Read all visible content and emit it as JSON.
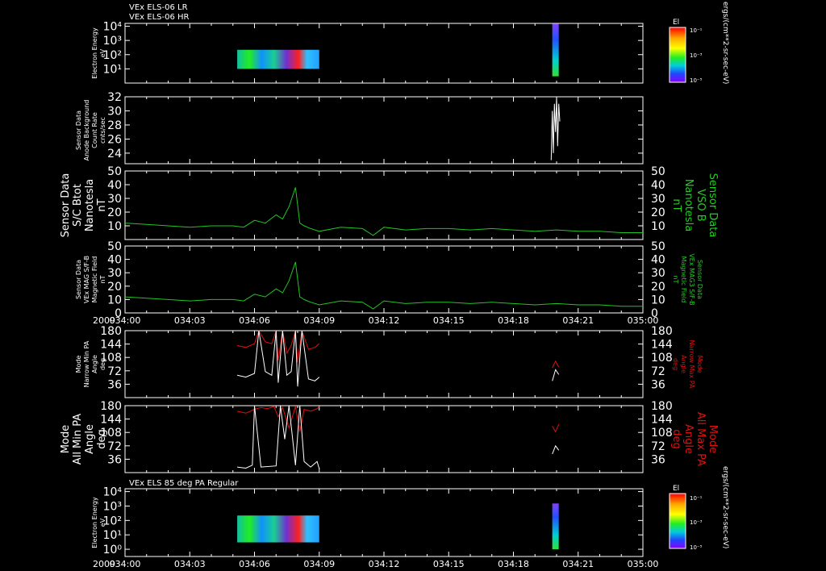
{
  "header": {
    "line1": "VEx ELS-06 LR",
    "line2": "VEx ELS-06 HR",
    "bottom_panel_title": "VEx ELS 85 deg PA Regular"
  },
  "colors": {
    "background": "#000000",
    "axis": "#ffffff",
    "green_series": "#22c422",
    "red_series": "#e01010",
    "white_series": "#ffffff",
    "green_label": "#22cc22",
    "red_label": "#dd1111"
  },
  "colorbar": {
    "label": "El",
    "ticks": [
      "10⁻¹",
      "10⁻³",
      "10⁻⁵"
    ],
    "units": "ergs/(cm**2-sr-sec-eV)"
  },
  "time_axis": {
    "year": "2009",
    "ticks": [
      "034:00",
      "034:03",
      "034:06",
      "034:09",
      "034:12",
      "034:15",
      "034:18",
      "034:21",
      "035:00"
    ]
  },
  "chart_data": [
    {
      "type": "heatmap",
      "panel": "spectrogram-top",
      "ylabel": [
        "Electron Energy",
        "eV"
      ],
      "yticks": [
        "10⁴",
        "10³",
        "10²",
        "10¹"
      ],
      "log_y": true,
      "ylim_log10": [
        0,
        4.2
      ],
      "blocks": [
        {
          "x_start": "034:05.2",
          "x_end": "034:09.0",
          "energy_min": 10,
          "energy_max": 220
        },
        {
          "x_start": "034:19.8",
          "x_end": "034:20.1",
          "energy_min": 3,
          "energy_max": 15000
        }
      ]
    },
    {
      "type": "line",
      "panel": "anode-background",
      "ylabel": [
        "Sensor Data",
        "Anode Background",
        "Count Rate",
        "cnts/sec"
      ],
      "yticks": [
        "32",
        "30",
        "28",
        "26",
        "24"
      ],
      "ylim": [
        22.5,
        32
      ],
      "series": [
        {
          "color": "white",
          "x": [
            19.75,
            19.8,
            19.85,
            19.9,
            19.95,
            20.0,
            20.05,
            20.1,
            20.15
          ],
          "y": [
            23,
            30,
            24,
            31,
            27,
            32,
            25,
            31,
            28.5
          ]
        }
      ]
    },
    {
      "type": "line",
      "panel": "bmag-sc",
      "ylabel": [
        "Sensor Data",
        "S/C Btot",
        "Nanotesla",
        "nT"
      ],
      "right_label": [
        "Sensor Data",
        "VSO B",
        "Nanotesla",
        "nT"
      ],
      "yticks": [
        "50",
        "40",
        "30",
        "20",
        "10"
      ],
      "ylim": [
        0,
        50
      ],
      "series": [
        {
          "color": "green",
          "x": [
            0,
            1,
            2,
            3,
            4,
            5,
            5.5,
            6,
            6.5,
            7,
            7.3,
            7.6,
            7.9,
            8.1,
            8.3,
            8.6,
            9,
            10,
            11,
            11.5,
            12,
            13,
            14,
            15,
            16,
            17,
            18,
            19,
            20,
            21,
            22,
            23,
            24
          ],
          "y": [
            12,
            11,
            10,
            9,
            10,
            10,
            9,
            14,
            12,
            18,
            15,
            24,
            38,
            12,
            10,
            8,
            6,
            9,
            8,
            3,
            9,
            7,
            8,
            8,
            7,
            8,
            7,
            6,
            7,
            6,
            6,
            5,
            5
          ]
        }
      ]
    },
    {
      "type": "line",
      "panel": "bmag-mag",
      "ylabel": [
        "Sensor Data",
        "VEx MAG S/F-B",
        "Magnetic Field",
        "nT"
      ],
      "right_label": [
        "Sensor Data",
        "VEx MAG3 S/F-B",
        "Magnetic Field",
        "nT"
      ],
      "yticks": [
        "50",
        "40",
        "30",
        "20",
        "10",
        "0"
      ],
      "ylim": [
        0,
        50
      ],
      "series": [
        {
          "color": "green",
          "x": [
            0,
            1,
            2,
            3,
            4,
            5,
            5.5,
            6,
            6.5,
            7,
            7.3,
            7.6,
            7.9,
            8.1,
            8.3,
            8.6,
            9,
            10,
            11,
            11.5,
            12,
            13,
            14,
            15,
            16,
            17,
            18,
            19,
            20,
            21,
            22,
            23,
            24
          ],
          "y": [
            12,
            11,
            10,
            9,
            10,
            10,
            9,
            14,
            12,
            18,
            15,
            24,
            38,
            12,
            10,
            8,
            6,
            9,
            8,
            3,
            9,
            7,
            8,
            8,
            7,
            8,
            7,
            6,
            7,
            6,
            6,
            5,
            5
          ]
        }
      ]
    },
    {
      "type": "line",
      "panel": "pa-narrow",
      "ylabel": [
        "Mode",
        "Narrow Min PA",
        "Angle",
        "deg"
      ],
      "right_label": [
        "Mode",
        "Narrow Max PA",
        "Angle",
        "deg"
      ],
      "yticks": [
        "180",
        "144",
        "108",
        "72",
        "36"
      ],
      "ylim": [
        0,
        180
      ],
      "series": [
        {
          "color": "red",
          "x": [
            5.2,
            5.6,
            6.0,
            6.2,
            6.5,
            6.8,
            7.0,
            7.1,
            7.3,
            7.5,
            7.7,
            7.9,
            8.0,
            8.2,
            8.5,
            8.8,
            9.0
          ],
          "y": [
            140,
            135,
            145,
            180,
            150,
            145,
            180,
            100,
            180,
            120,
            140,
            180,
            95,
            180,
            130,
            135,
            145
          ]
        },
        {
          "color": "white",
          "x": [
            5.2,
            5.6,
            6.0,
            6.2,
            6.5,
            6.8,
            7.0,
            7.1,
            7.3,
            7.5,
            7.7,
            7.9,
            8.0,
            8.2,
            8.5,
            8.8,
            9.0
          ],
          "y": [
            60,
            55,
            65,
            180,
            70,
            60,
            180,
            40,
            180,
            60,
            70,
            180,
            30,
            180,
            50,
            45,
            55
          ]
        },
        {
          "color": "red",
          "x": [
            19.8,
            19.95,
            20.1
          ],
          "y": [
            80,
            98,
            82
          ]
        },
        {
          "color": "white",
          "x": [
            19.8,
            19.95,
            20.1
          ],
          "y": [
            45,
            75,
            62
          ]
        }
      ]
    },
    {
      "type": "line",
      "panel": "pa-all",
      "ylabel": [
        "Mode",
        "All Min PA",
        "Angle",
        "deg"
      ],
      "right_label": [
        "Mode",
        "All Max PA",
        "Angle",
        "deg"
      ],
      "yticks": [
        "180",
        "144",
        "108",
        "72",
        "36"
      ],
      "ylim": [
        0,
        180
      ],
      "series": [
        {
          "color": "red",
          "x": [
            5.2,
            5.6,
            6.0,
            6.3,
            6.6,
            6.9,
            7.1,
            7.3,
            7.6,
            7.9,
            8.1,
            8.3,
            8.6,
            8.9,
            9.0
          ],
          "y": [
            165,
            160,
            170,
            175,
            172,
            178,
            150,
            175,
            120,
            178,
            110,
            170,
            165,
            172,
            178
          ]
        },
        {
          "color": "white",
          "x": [
            5.2,
            5.6,
            5.9,
            6.0,
            6.3,
            7.0,
            7.2,
            7.4,
            7.6,
            7.9,
            8.1,
            8.3,
            8.6,
            8.9,
            9.0
          ],
          "y": [
            15,
            12,
            20,
            180,
            15,
            18,
            180,
            90,
            180,
            20,
            180,
            30,
            15,
            30,
            10
          ]
        },
        {
          "color": "red",
          "x": [
            19.8,
            19.95,
            20.1
          ],
          "y": [
            125,
            110,
            130
          ]
        },
        {
          "color": "white",
          "x": [
            19.8,
            19.95,
            20.1
          ],
          "y": [
            50,
            72,
            60
          ]
        }
      ]
    },
    {
      "type": "heatmap",
      "panel": "spectrogram-bottom",
      "ylabel": [
        "Electron Energy",
        "eV"
      ],
      "yticks": [
        "10⁴",
        "10³",
        "10²",
        "10¹",
        "10⁰"
      ],
      "log_y": true,
      "ylim_log10": [
        -0.5,
        4.2
      ],
      "blocks": [
        {
          "x_start": "034:05.2",
          "x_end": "034:09.0",
          "energy_min": 3,
          "energy_max": 220
        },
        {
          "x_start": "034:19.8",
          "x_end": "034:20.1",
          "energy_min": 1,
          "energy_max": 1500
        }
      ]
    }
  ]
}
